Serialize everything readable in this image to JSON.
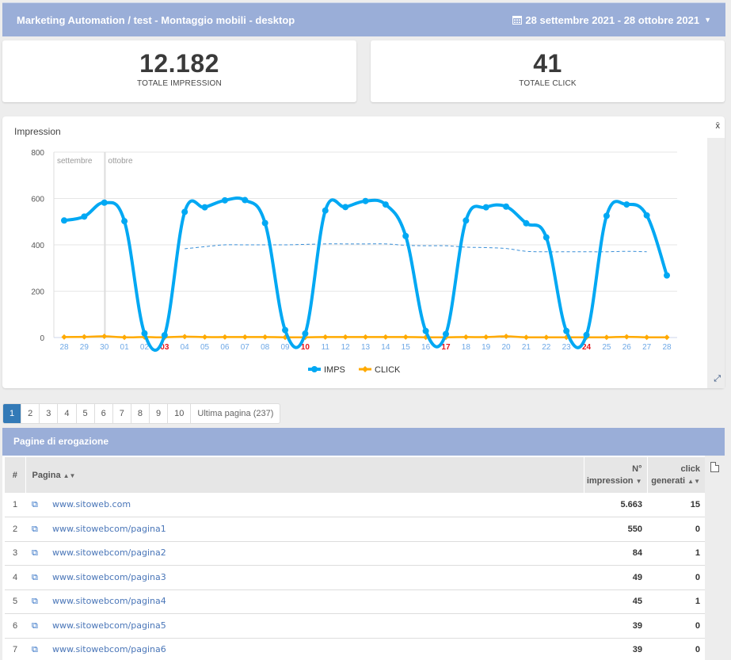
{
  "topbar": {
    "breadcrumb": "Marketing Automation / test - Montaggio mobili - desktop",
    "date_range": "28 settembre 2021 - 28 ottobre 2021",
    "calendar_icon": "calendar-icon",
    "caret_icon": "caret-down-icon"
  },
  "kpis": {
    "impressions": {
      "value": "12.182",
      "label": "TOTALE IMPRESSION"
    },
    "clicks": {
      "value": "41",
      "label": "TOTALE CLICK"
    }
  },
  "chart_card": {
    "title": "Impression",
    "mean_toggle_label": "x̄",
    "expand_icon": "expand-icon"
  },
  "chart_data": {
    "type": "line",
    "title": "Impression",
    "xlabel": "",
    "ylabel": "",
    "ylim": [
      0,
      800
    ],
    "yticks": [
      0,
      200,
      400,
      600,
      800
    ],
    "grid": true,
    "legend": "bottom",
    "month_markers": [
      {
        "label": "settembre",
        "at_index": 0
      },
      {
        "label": "ottobre",
        "at_index": 3
      }
    ],
    "x": [
      "28",
      "29",
      "30",
      "01",
      "02",
      "03",
      "04",
      "05",
      "06",
      "07",
      "08",
      "09",
      "10",
      "11",
      "12",
      "13",
      "14",
      "15",
      "16",
      "17",
      "18",
      "19",
      "20",
      "21",
      "22",
      "23",
      "24",
      "25",
      "26",
      "27",
      "28"
    ],
    "highlighted_x": [
      "03",
      "10",
      "17",
      "24"
    ],
    "series": [
      {
        "name": "IMPS",
        "color": "#00a8f3",
        "values": [
          505,
          522,
          582,
          502,
          18,
          10,
          542,
          562,
          592,
          593,
          494,
          32,
          17,
          548,
          563,
          589,
          574,
          438,
          28,
          15,
          505,
          562,
          565,
          493,
          432,
          28,
          11,
          525,
          574,
          527,
          268
        ]
      },
      {
        "name": "CLICK",
        "color": "#ffaa00",
        "values": [
          2,
          3,
          5,
          1,
          2,
          1,
          4,
          2,
          2,
          2,
          2,
          1,
          1,
          2,
          2,
          2,
          2,
          2,
          1,
          1,
          2,
          2,
          5,
          1,
          1,
          1,
          1,
          1,
          3,
          1,
          1
        ]
      },
      {
        "name": "IMPS moving average",
        "color": "#3a8fd8",
        "dashed": true,
        "values": [
          null,
          null,
          null,
          null,
          null,
          null,
          383,
          392,
          400,
          400,
          400,
          400,
          402,
          404,
          404,
          404,
          404,
          398,
          396,
          396,
          390,
          388,
          384,
          372,
          370,
          370,
          370,
          370,
          372,
          370,
          null
        ]
      }
    ]
  },
  "pagination": {
    "pages": [
      "1",
      "2",
      "3",
      "4",
      "5",
      "6",
      "7",
      "8",
      "9",
      "10"
    ],
    "active": "1",
    "last_label": "Ultima pagina (237)"
  },
  "table": {
    "title": "Pagine di erogazione",
    "columns": {
      "num": "#",
      "page": "Pagina",
      "impressions_line1": "N°",
      "impressions_line2": "impression",
      "clicks_line1": "click",
      "clicks_line2": "generati"
    },
    "rows": [
      {
        "n": "1",
        "page": "www.sitoweb.com",
        "impressions": "5.663",
        "clicks": "15"
      },
      {
        "n": "2",
        "page": "www.sitowebcom/pagina1",
        "impressions": "550",
        "clicks": "0"
      },
      {
        "n": "3",
        "page": "www.sitowebcom/pagina2",
        "impressions": "84",
        "clicks": "1"
      },
      {
        "n": "4",
        "page": "www.sitowebcom/pagina3",
        "impressions": "49",
        "clicks": "0"
      },
      {
        "n": "5",
        "page": "www.sitowebcom/pagina4",
        "impressions": "45",
        "clicks": "1"
      },
      {
        "n": "6",
        "page": "www.sitowebcom/pagina5",
        "impressions": "39",
        "clicks": "0"
      },
      {
        "n": "7",
        "page": "www.sitowebcom/pagina6",
        "impressions": "39",
        "clicks": "0"
      }
    ]
  },
  "colors": {
    "header_bg": "#9aaed8",
    "accent": "#337ab7",
    "imps": "#00a8f3",
    "click": "#ffaa00",
    "weekend_label": "#e8141c",
    "tick_label": "#6ea8e6"
  }
}
